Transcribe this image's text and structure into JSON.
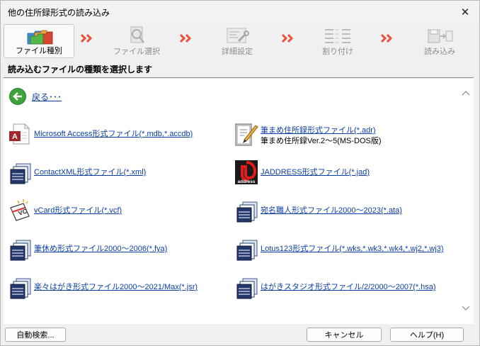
{
  "window": {
    "title": "他の住所録形式の読み込み",
    "close_glyph": "✕"
  },
  "wizard": {
    "steps": [
      {
        "label": "ファイル種別",
        "active": true,
        "icon": "folders-icon"
      },
      {
        "label": "ファイル選択",
        "active": false,
        "icon": "file-search-icon"
      },
      {
        "label": "詳細設定",
        "active": false,
        "icon": "settings-icon"
      },
      {
        "label": "割り付け",
        "active": false,
        "icon": "mapping-icon"
      },
      {
        "label": "読み込み",
        "active": false,
        "icon": "save-import-icon"
      }
    ],
    "arrow_color": "#e8523a"
  },
  "subheader": "読み込むファイルの種類を選択します",
  "back": {
    "label": "戻る･･･",
    "icon": "back-arrow-icon"
  },
  "file_types": {
    "left": [
      {
        "label": "Microsoft Access形式ファイル(*.mdb,*.accdb)",
        "icon": "access-file-icon"
      },
      {
        "label": "ContactXML形式ファイル(*.xml)",
        "icon": "address-book-icon"
      },
      {
        "label": "vCard形式ファイル(*.vcf)",
        "icon": "vcard-icon"
      },
      {
        "label": "筆休め形式ファイル2000～2006(*.fya)",
        "icon": "address-book-icon"
      },
      {
        "label": "楽々はがき形式ファイル2000～2021/Max(*.jsr)",
        "icon": "address-book-icon"
      }
    ],
    "right": [
      {
        "label": "筆まめ住所録形式ファイル(*.adr)",
        "desc": "筆まめ住所録Ver.2～5(MS-DOS版)",
        "icon": "fudemame-icon"
      },
      {
        "label": "JADDRESS形式ファイル(*.jad)",
        "icon": "jaddress-icon",
        "icon_text": "address"
      },
      {
        "label": "宛名職人形式ファイル2000～2023(*.ata)",
        "icon": "address-book-icon"
      },
      {
        "label": "Lotus123形式ファイル(*.wks,*.wk3,*.wk4,*.wj2,*.wj3)",
        "icon": "address-book-icon"
      },
      {
        "label": "はがきスタジオ形式ファイル/2/2000～2007(*.hsa)",
        "icon": "address-book-icon"
      }
    ]
  },
  "footer": {
    "auto_search": "自動検索...",
    "cancel": "キャンセル",
    "help": "ヘルプ(H)"
  },
  "colors": {
    "link": "#0b3fa5",
    "back_green": "#3ea33a",
    "disabled_text": "#8d8d8d"
  }
}
